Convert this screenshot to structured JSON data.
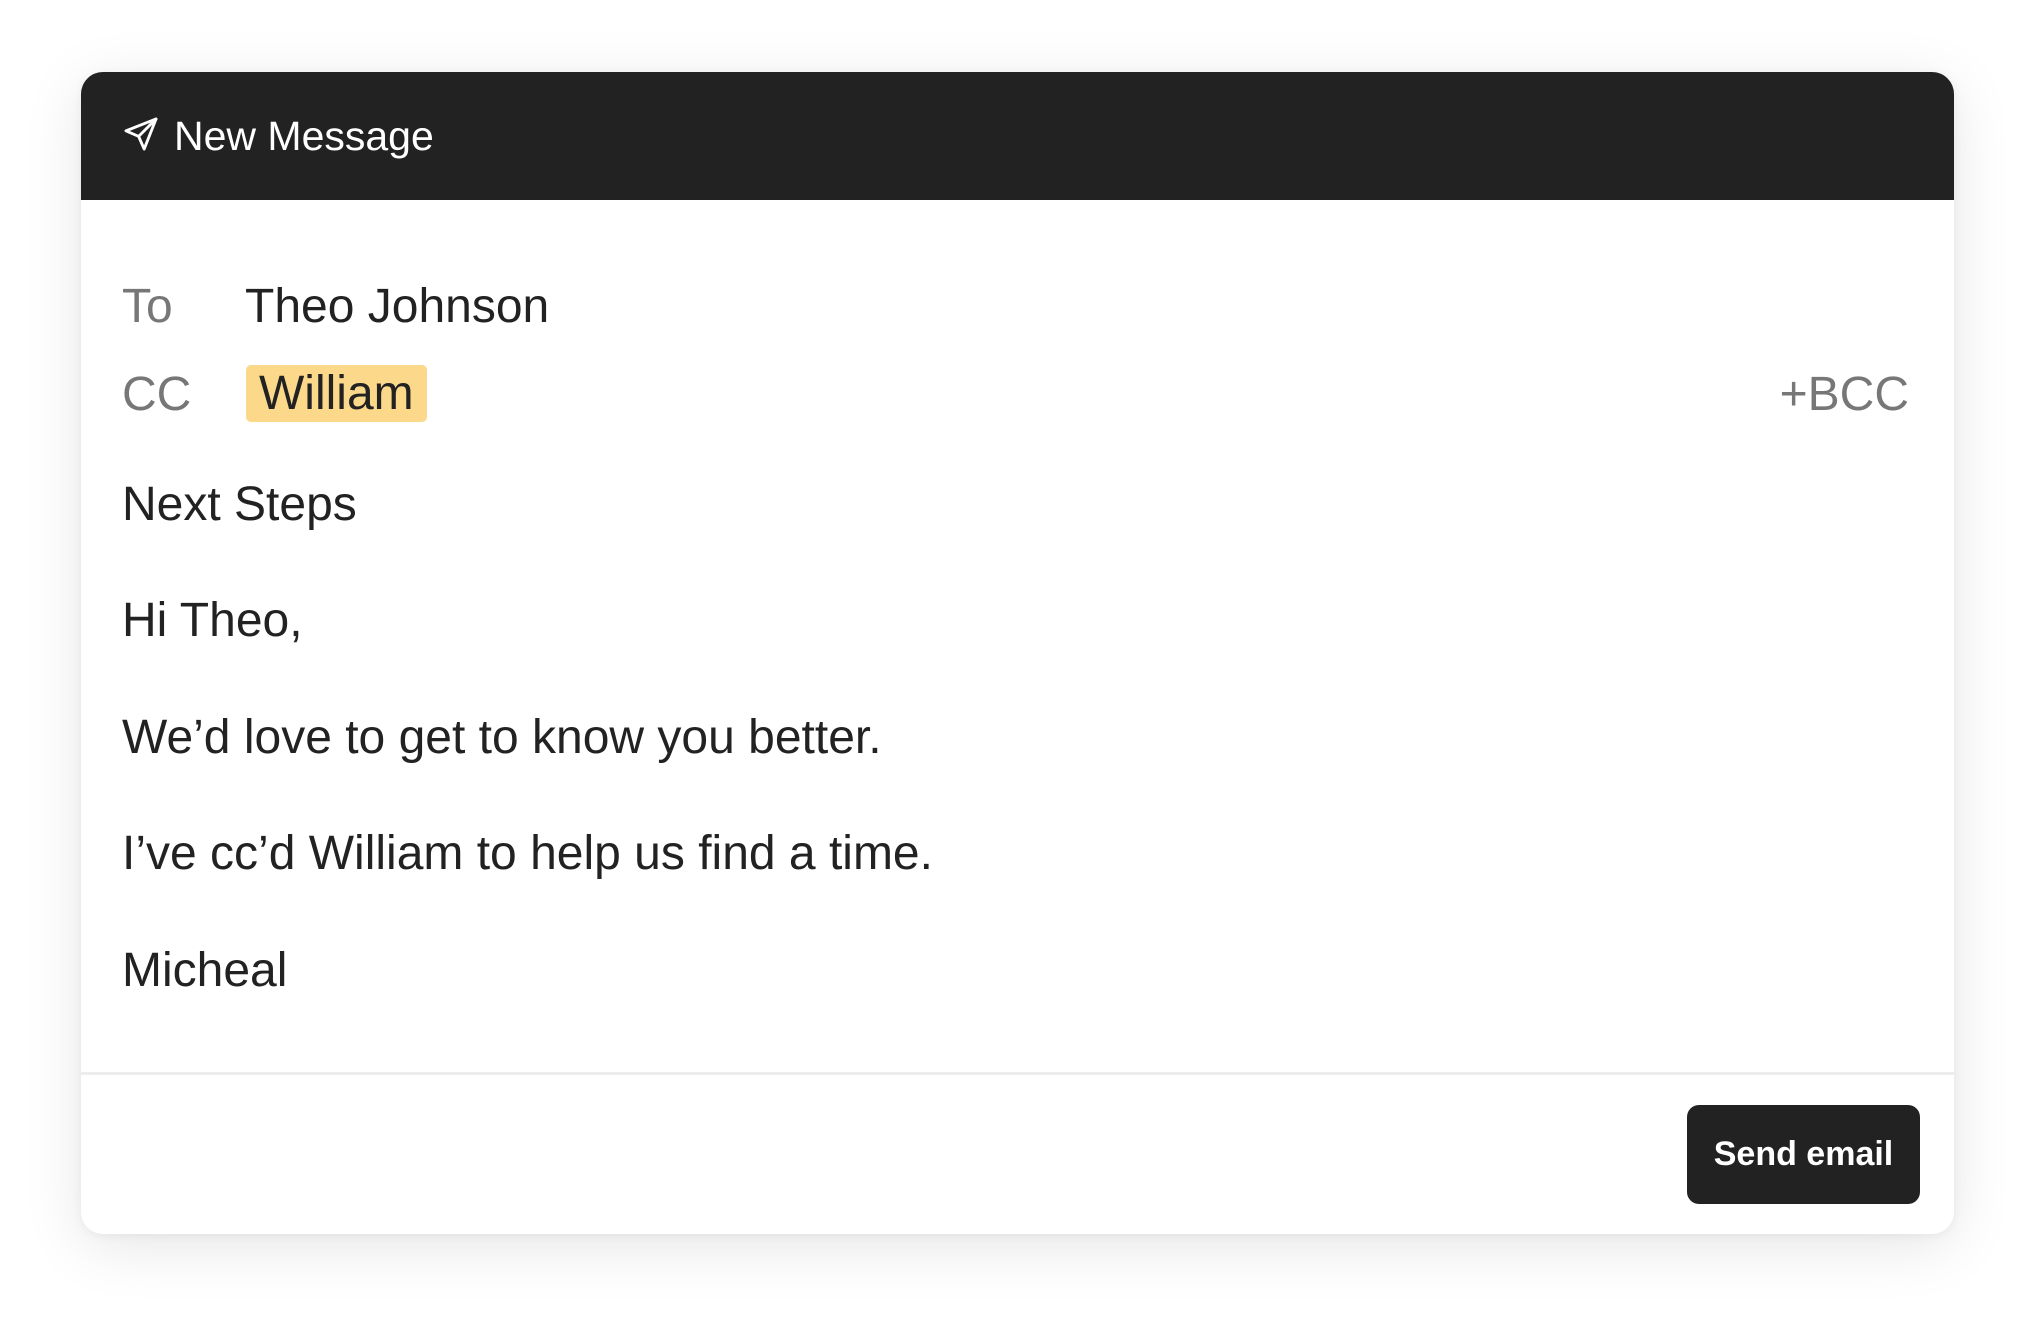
{
  "window": {
    "title": "New Message",
    "title_icon": "send-icon"
  },
  "recipients": {
    "to_label": "To",
    "to_value": "Theo Johnson",
    "cc_label": "CC",
    "cc_chips": [
      "William"
    ],
    "bcc_label": "+BCC"
  },
  "message": {
    "subject": "Next Steps",
    "body_lines": [
      "Hi Theo,",
      "We’d love to get to know you better.",
      "I’ve cc’d William to help us find a time.",
      "Micheal"
    ]
  },
  "footer": {
    "send_label": "Send email"
  },
  "colors": {
    "header_bg": "#222222",
    "chip_bg": "#fbd88a",
    "label_gray": "#777777",
    "text": "#222222",
    "button_bg": "#222222"
  }
}
